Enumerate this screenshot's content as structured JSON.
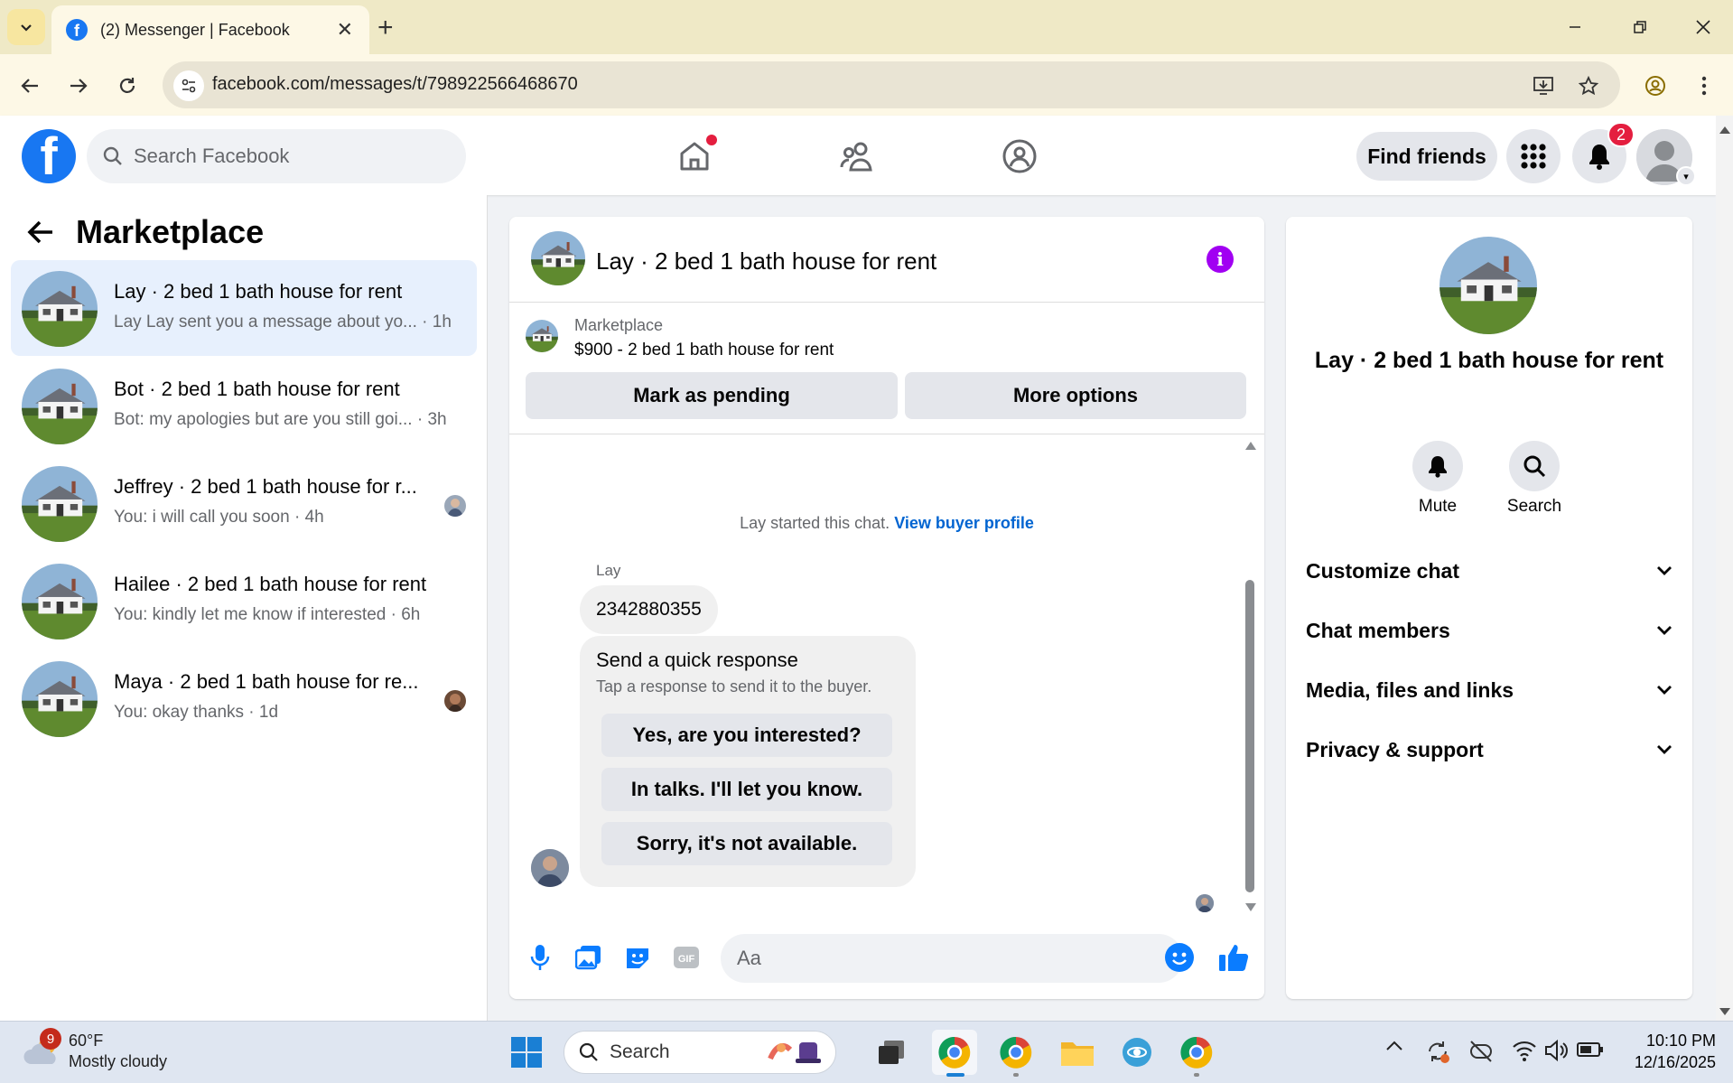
{
  "browser": {
    "tab_title": "(2) Messenger | Facebook",
    "url": "facebook.com/messages/t/798922566468670"
  },
  "fb": {
    "search_placeholder": "Search Facebook",
    "find_friends": "Find friends",
    "notification_count": "2"
  },
  "left": {
    "title": "Marketplace",
    "conversations": [
      {
        "title": "Lay · 2 bed 1 bath house for rent",
        "subtitle": "Lay Lay sent you a message about yo... · 1h"
      },
      {
        "title": "Bot · 2 bed 1 bath house for rent",
        "subtitle": "Bot: my apologies but are you still goi... · 3h"
      },
      {
        "title": "Jeffrey · 2 bed 1 bath house for r...",
        "subtitle": "You: i will call you soon · 4h"
      },
      {
        "title": "Hailee · 2 bed 1 bath house for rent",
        "subtitle": "You: kindly let me know if interested · 6h"
      },
      {
        "title": "Maya · 2 bed 1 bath house for re...",
        "subtitle": "You: okay thanks · 1d"
      }
    ]
  },
  "chat": {
    "title": "Lay · 2 bed 1 bath house for rent",
    "marketplace_label": "Marketplace",
    "listing": "$900 - 2 bed 1 bath house for rent",
    "mark_pending": "Mark as pending",
    "more_options": "More options",
    "started_text": "Lay started this chat.",
    "view_buyer": "View buyer profile",
    "sender": "Lay",
    "message": "2342880355",
    "quick_title": "Send a quick response",
    "quick_sub": "Tap a response to send it to the buyer.",
    "quick_responses": [
      "Yes, are you interested?",
      "In talks. I'll let you know.",
      "Sorry, it's not available."
    ],
    "composer_placeholder": "Aa"
  },
  "right": {
    "title": "Lay · 2 bed 1 bath house for rent",
    "mute": "Mute",
    "search": "Search",
    "sections": [
      "Customize chat",
      "Chat members",
      "Media, files and links",
      "Privacy & support"
    ]
  },
  "taskbar": {
    "weather_badge": "9",
    "temperature": "60°F",
    "condition": "Mostly cloudy",
    "search": "Search",
    "time": "10:10 PM",
    "date": "12/16/2025"
  },
  "colors": {
    "facebook_blue": "#1877f2",
    "info_purple": "#a100f2",
    "notification_red": "#e41e3f",
    "active_conversation": "#e7f0fd"
  }
}
